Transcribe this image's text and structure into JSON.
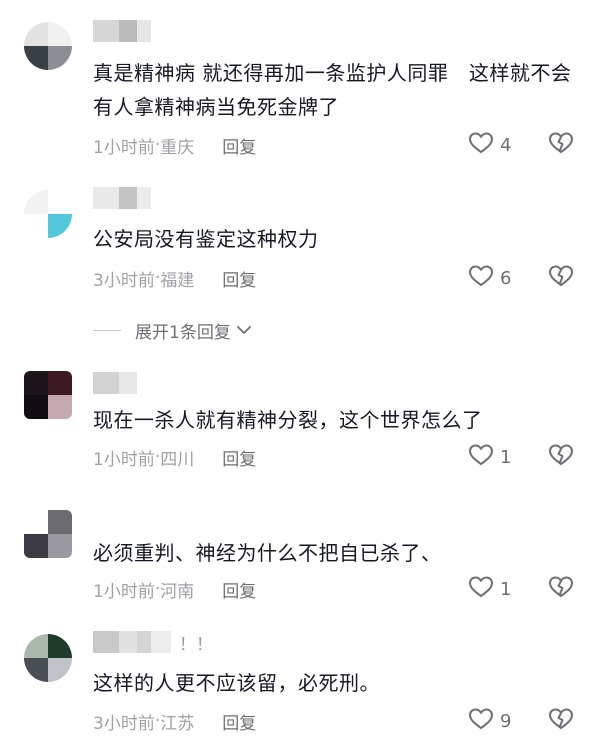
{
  "colors": {
    "text_primary": "#161823",
    "text_secondary": "#a0a0a5",
    "reply": "#6e6e73",
    "icon_stroke": "#6e6e73"
  },
  "icons": {
    "like": "heart-outline-icon",
    "dislike": "broken-heart-icon",
    "expand": "chevron-down-icon"
  },
  "comments": [
    {
      "text": "真是精神病 就还得再加一条监护人同罪　这样就不会有人拿精神病当免死金牌了",
      "time": "1小时前",
      "sep": " · ",
      "location": "重庆",
      "reply_label": "回复",
      "likes": "4",
      "avatar_colors": [
        "#e2e2e2",
        "#f0f0f0",
        "#3a3f44",
        "#8b8f94"
      ],
      "name_mosaic": [
        "#d6d6d6",
        "#b9b9b9",
        "#e6e6e6"
      ]
    },
    {
      "text": "公安局没有鉴定这种权力",
      "time": "3小时前",
      "sep": " · ",
      "location": "福建",
      "reply_label": "回复",
      "likes": "6",
      "avatar_colors": [
        "#f2f2f2",
        "#ffffff",
        "#ffffff",
        "#53c8dd"
      ],
      "name_mosaic": [
        "#e9e9e9",
        "#c3c3c3",
        "#ececec"
      ]
    },
    {
      "text": "现在一杀人就有精神分裂，这个世界怎么了",
      "time": "1小时前",
      "sep": " · ",
      "location": "四川",
      "reply_label": "回复",
      "likes": "1",
      "avatar_colors": [
        "#1c1418",
        "#3d1a22",
        "#120d10",
        "#c6a9b0"
      ],
      "name_mosaic": [
        "#d2d2d2",
        "#e7e7e7"
      ]
    },
    {
      "text": "必须重判、神经为什么不把自已杀了、",
      "time": "1小时前",
      "sep": " · ",
      "location": "河南",
      "reply_label": "回复",
      "likes": "1",
      "avatar_colors": [
        "#ffffff",
        "#6b6b70",
        "#3a3a40",
        "#9a9aa0"
      ],
      "name_mosaic": []
    },
    {
      "text": "这样的人更不应该留，必死刑。",
      "time": "3小时前",
      "sep": " · ",
      "location": "江苏",
      "reply_label": "回复",
      "likes": "9",
      "username_visible": "！！",
      "avatar_colors": [
        "#aab8ad",
        "#1e3a28",
        "#4a4f55",
        "#bfc2c6"
      ],
      "name_mosaic": [
        "#c8c8c8",
        "#e0e0e0",
        "#d4d4d4",
        "#ededed"
      ]
    }
  ],
  "expand_replies": {
    "label": "展开1条回复"
  }
}
